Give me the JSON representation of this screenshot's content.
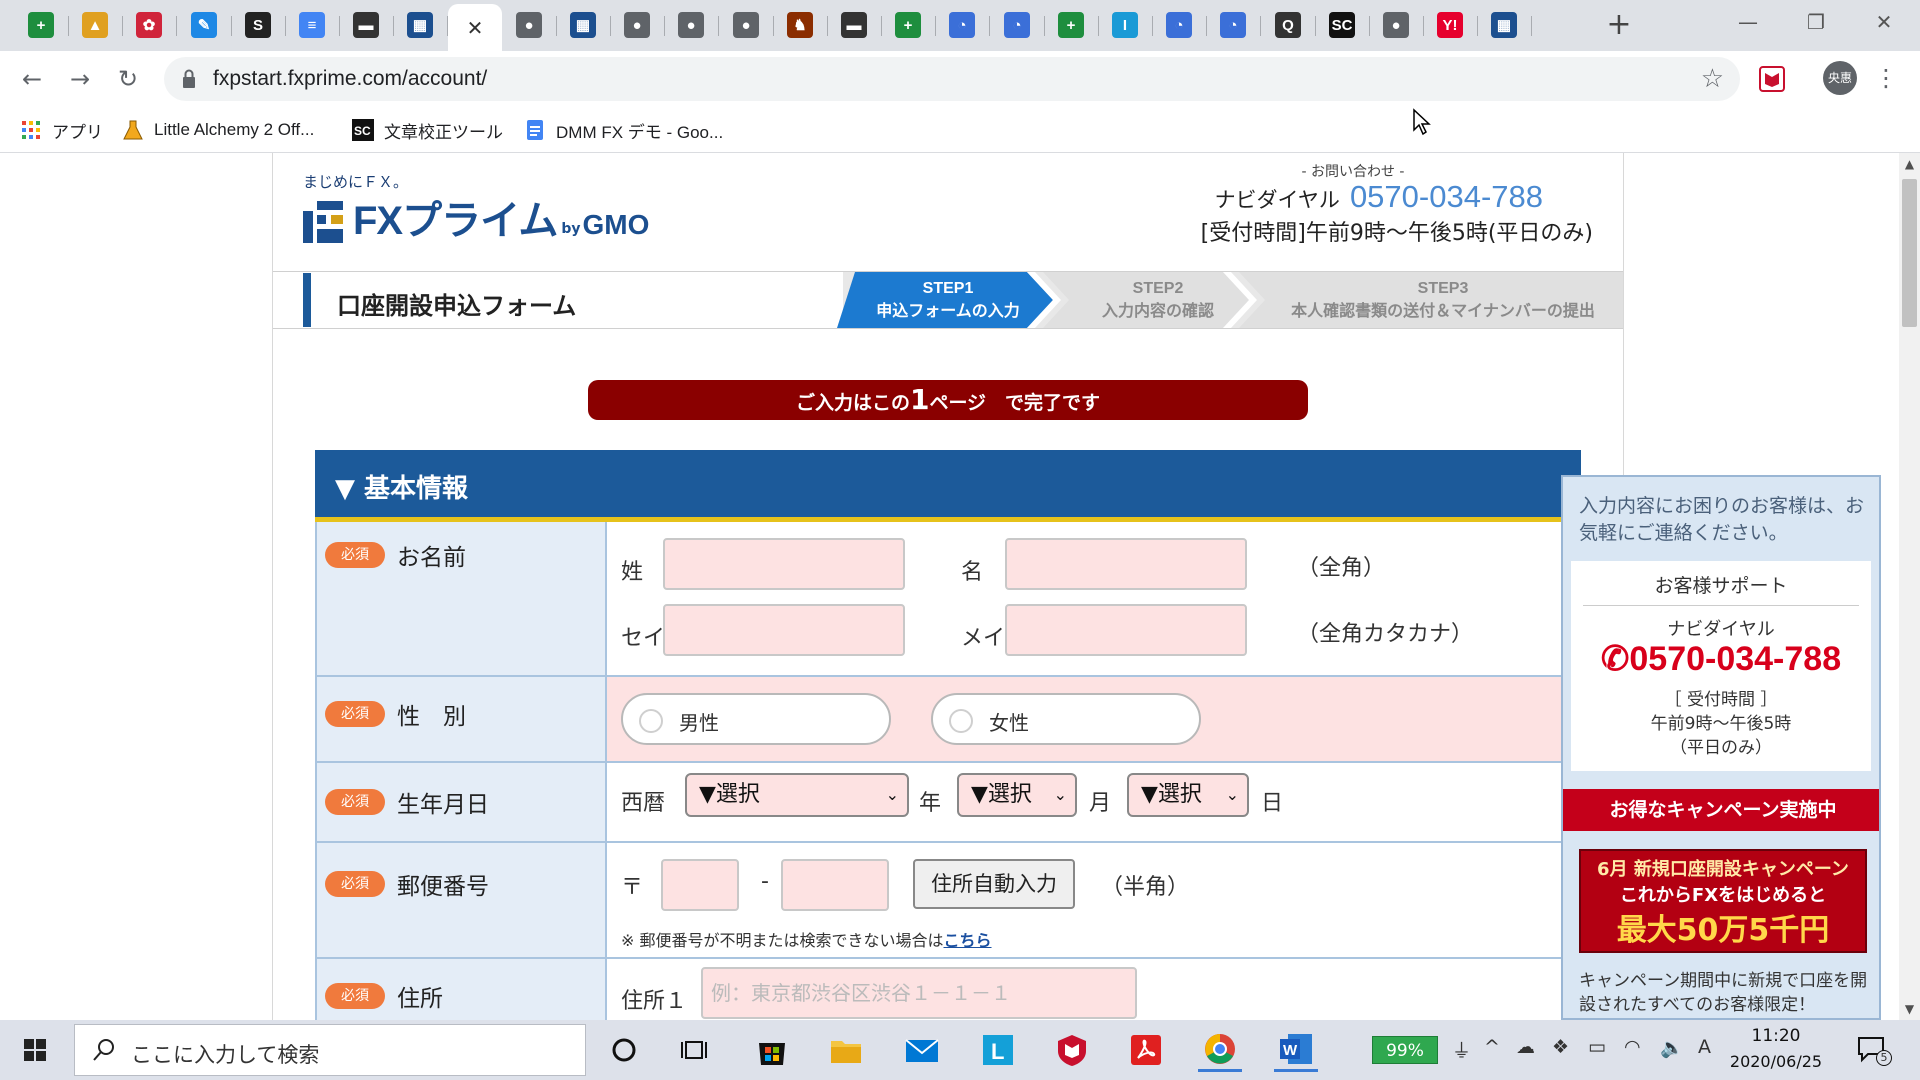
{
  "browser": {
    "url": "fxpstart.fxprime.com/account/",
    "tab_close_glyph": "✕",
    "new_tab_glyph": "+",
    "tabs": [
      {
        "icon": "green-plus-icon",
        "glyph": "+",
        "color": "#1e8e3e"
      },
      {
        "icon": "alchemy-flask-icon",
        "glyph": "▲",
        "color": "#e0a020"
      },
      {
        "icon": "red-flower-icon",
        "glyph": "✿",
        "color": "#d0243b"
      },
      {
        "icon": "blue-feather-icon",
        "glyph": "✎",
        "color": "#1e88e5"
      },
      {
        "icon": "s-letter-icon",
        "glyph": "S",
        "color": "#222222"
      },
      {
        "icon": "google-docs-icon",
        "glyph": "≡",
        "color": "#4285f4"
      },
      {
        "icon": "dark-site-icon",
        "glyph": "▬",
        "color": "#333333"
      },
      {
        "icon": "fxprime-icon",
        "glyph": "▦",
        "color": "#1c4f8f"
      },
      {
        "icon": "globe-icon",
        "glyph": "●",
        "color": "#5f6368"
      },
      {
        "icon": "fxprime-icon",
        "glyph": "▦",
        "color": "#1c4f8f"
      },
      {
        "icon": "globe-icon",
        "glyph": "●",
        "color": "#5f6368"
      },
      {
        "icon": "globe-icon",
        "glyph": "●",
        "color": "#5f6368"
      },
      {
        "icon": "globe-icon",
        "glyph": "●",
        "color": "#5f6368"
      },
      {
        "icon": "samurai-icon",
        "glyph": "♞",
        "color": "#8b2d00"
      },
      {
        "icon": "dark-site-icon",
        "glyph": "▬",
        "color": "#333333"
      },
      {
        "icon": "green-plus-icon",
        "glyph": "+",
        "color": "#1e8e3e"
      },
      {
        "icon": "blue-clock-icon",
        "glyph": "◔",
        "color": "#3b6fd8"
      },
      {
        "icon": "blue-clock-icon",
        "glyph": "◔",
        "color": "#3b6fd8"
      },
      {
        "icon": "green-plus-icon",
        "glyph": "+",
        "color": "#1e8e3e"
      },
      {
        "icon": "i-letter-icon",
        "glyph": "I",
        "color": "#1a9ad6"
      },
      {
        "icon": "blue-clock-icon",
        "glyph": "◔",
        "color": "#3b6fd8"
      },
      {
        "icon": "blue-clock-icon",
        "glyph": "◔",
        "color": "#3b6fd8"
      },
      {
        "icon": "magnifier-icon",
        "glyph": "Q",
        "color": "#333333"
      },
      {
        "icon": "sc-logo-icon",
        "glyph": "SC",
        "color": "#111111"
      },
      {
        "icon": "globe-icon",
        "glyph": "●",
        "color": "#5f6368"
      },
      {
        "icon": "yahoo-icon",
        "glyph": "Y!",
        "color": "#e6002d"
      },
      {
        "icon": "fxprime-icon",
        "glyph": "▦",
        "color": "#1c4f8f"
      }
    ],
    "bookmarks": [
      {
        "label": "アプリ",
        "icon": "apps-grid-icon"
      },
      {
        "label": "Little Alchemy 2 Off...",
        "icon": "alchemy-flask-icon"
      },
      {
        "label": "文章校正ツール",
        "icon": "sc-logo-icon"
      },
      {
        "label": "DMM FX デモ - Goo...",
        "icon": "google-docs-icon"
      }
    ],
    "profile_initials": "央惠",
    "nav": {
      "back": "←",
      "forward": "→",
      "reload": "↻",
      "star": "☆",
      "menu": "⋮"
    },
    "window": {
      "minimize": "—",
      "maximize": "❐",
      "close": "✕"
    }
  },
  "site": {
    "tagline": "まじめにＦＸ。",
    "logo_text": "FXプライム",
    "logo_by": "by",
    "logo_gmo": "GMO",
    "contact_label": "- お問い合わせ -",
    "contact_navi": "ナビダイヤル",
    "contact_phone": "0570-034-788",
    "contact_hours": "[受付時間]午前9時～午後5時(平日のみ)"
  },
  "steps": {
    "form_title": "口座開設申込フォーム",
    "items": [
      {
        "num": "STEP1",
        "label": "申込フォームの入力",
        "active": true
      },
      {
        "num": "STEP2",
        "label": "入力内容の確認",
        "active": false
      },
      {
        "num": "STEP3",
        "label": "本人確認書類の送付＆マイナンバーの提出",
        "active": false
      }
    ]
  },
  "banner": {
    "pre": "ご入力はこの",
    "big": "1",
    "post": "ページ　で完了です"
  },
  "section": {
    "title": "▼ 基本情報"
  },
  "form": {
    "required": "必須",
    "name": {
      "label": "お名前",
      "sei": "姓",
      "mei": "名",
      "zenkaku": "（全角）",
      "sei_kana": "セイ",
      "mei_kana": "メイ",
      "zenkaku_kana": "（全角カタカナ）"
    },
    "gender": {
      "label": "性　別",
      "male": "男性",
      "female": "女性"
    },
    "birth": {
      "label": "生年月日",
      "era": "西暦",
      "select": "▼選択",
      "year": "年",
      "month": "月",
      "day": "日"
    },
    "zip": {
      "label": "郵便番号",
      "mark": "〒",
      "dash": "-",
      "auto_button": "住所自動入力",
      "hankaku": "（半角）",
      "note": "※ 郵便番号が不明または検索できない場合は",
      "note_link": "こちら"
    },
    "address": {
      "label": "住所",
      "line1_label": "住所１",
      "line1_placeholder": "例：東京都渋谷区渋谷１－１－１"
    }
  },
  "support": {
    "intro": "入力内容にお困りのお客様は、お気軽にご連絡ください。",
    "title": "お客様サポート",
    "navi": "ナビダイヤル",
    "phone": "0570-034-788",
    "hours_label": "［ 受付時間 ］",
    "hours": "午前9時～午後5時",
    "days": "（平日のみ）",
    "campaign_ribbon": "お得なキャンペーン実施中",
    "campaign_line1": "6月 新規口座開設キャンペーン",
    "campaign_line2": "これからFXをはじめると",
    "campaign_line3": "最大50万5千円",
    "campaign_note": "キャンペーン期間中に新規で口座を開設されたすべてのお客様限定！"
  },
  "taskbar": {
    "search_placeholder": "ここに入力して検索",
    "battery": "99%",
    "ime": "A",
    "time": "11:20",
    "date": "2020/06/25",
    "notifications": "5"
  }
}
